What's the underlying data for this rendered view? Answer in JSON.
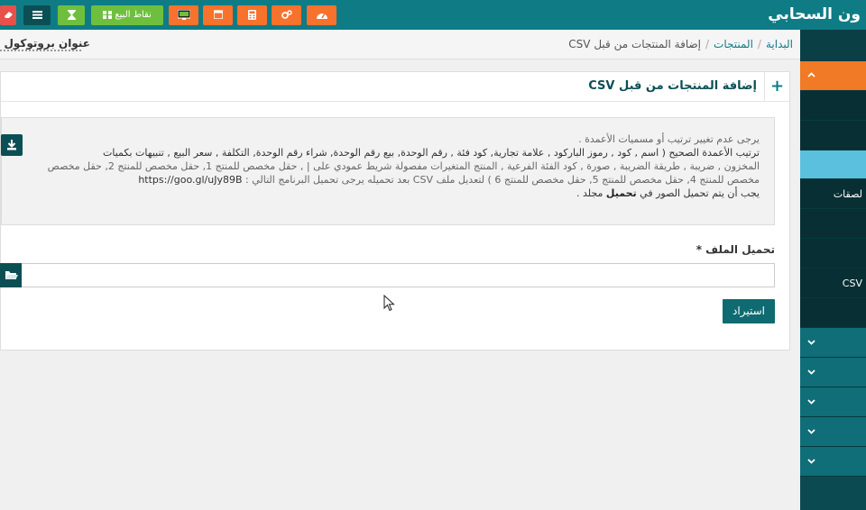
{
  "app": {
    "brand": "ون السحابي"
  },
  "topbar": {
    "pos_label": "نقاط البيع",
    "accent_orange": "#f7722c",
    "accent_green": "#6fbf3f",
    "header_color": "#0f7c85",
    "icons": [
      "dashboard-icon",
      "cogs-icon",
      "calculator-icon",
      "calendar-icon",
      "screen-icon",
      "grid-icon",
      "hourglass-icon",
      "list-icon",
      "eraser-icon"
    ]
  },
  "breadcrumb": {
    "home": "البداية",
    "products": "المنتجات",
    "current": "إضافة المنتجات من قبل CSV"
  },
  "store": {
    "title": "عنوان بروتوكول الإنت"
  },
  "panel": {
    "title": "إضافة المنتجات من قبل CSV",
    "info_line1": "يرجى عدم تغيير ترتيب أو مسميات الأعمدة .",
    "info_line2": "ترتيب الأعمدة الصحيح ( اسم , كود , رموز الباركود , علامة تجارية, كود فئة , رقم الوحدة, بيع رقم الوحدة, شراء رقم الوحدة, التكلفة , سعر البيع , تنبيهات بكميات",
    "info_line3": "المخزون , ضريبة , طريقة الضريبة , صورة , كود الفئة الفرعية , المنتج المتغيرات مفصولة شريط عمودي على | , حقل مخصص للمنتج 1, حقل مخصص للمنتج 2, حقل مخصص",
    "info_line4_text": "مخصص للمنتج 4, حقل مخصص للمنتج 5, حقل مخصص للمنتج 6 ) لتعديل ملف CSV بعد تحميله يرجى تحميل البرنامج التالي :",
    "info_line4_url": "https://goo.gl/uJy89B",
    "info_line5_pre": "يجب أن يتم تحميل الصور في",
    "info_line5_bold": "تحميل",
    "info_line5_post": "مجلد .",
    "file_label": "تحميل الملف *",
    "import_label": "استيراد"
  },
  "sidebar": {
    "labels": [
      "لصقات",
      "CSV"
    ]
  }
}
